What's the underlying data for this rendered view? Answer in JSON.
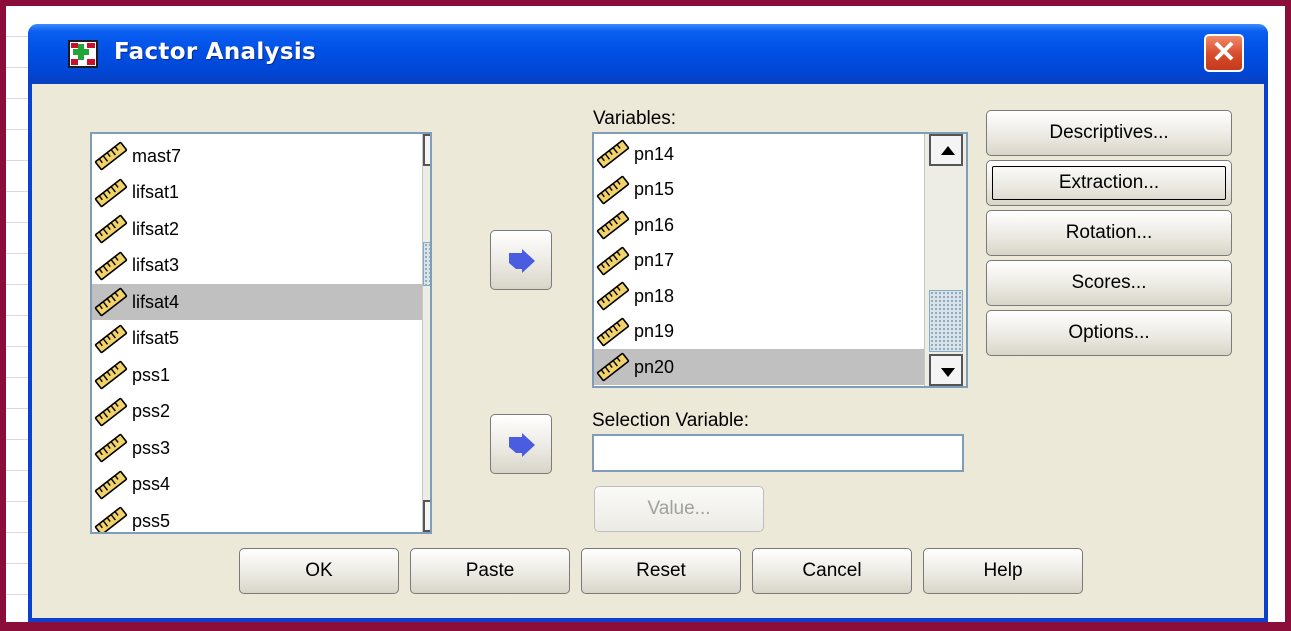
{
  "window": {
    "title": "Factor Analysis",
    "close_glyph": "✕",
    "icon": "spss-data-icon"
  },
  "source_list": {
    "items": [
      "mast7",
      "lifsat1",
      "lifsat2",
      "lifsat3",
      "lifsat4",
      "lifsat5",
      "pss1",
      "pss2",
      "pss3",
      "pss4",
      "pss5"
    ],
    "selected": "lifsat4"
  },
  "variables": {
    "label": "Variables:",
    "items": [
      "pn14",
      "pn15",
      "pn16",
      "pn17",
      "pn18",
      "pn19",
      "pn20"
    ],
    "selected": "pn20"
  },
  "selection_variable": {
    "label": "Selection Variable:",
    "value": "",
    "value_button": "Value..."
  },
  "side_buttons": [
    "Descriptives...",
    "Extraction...",
    "Rotation...",
    "Scores...",
    "Options..."
  ],
  "bottom_buttons": [
    "OK",
    "Paste",
    "Reset",
    "Cancel",
    "Help"
  ],
  "colors": {
    "frame": "#8b0d3a",
    "title_bar": "#0050e6",
    "dialog_bg": "#ece9d8",
    "arrow": "#4a5ce0"
  }
}
